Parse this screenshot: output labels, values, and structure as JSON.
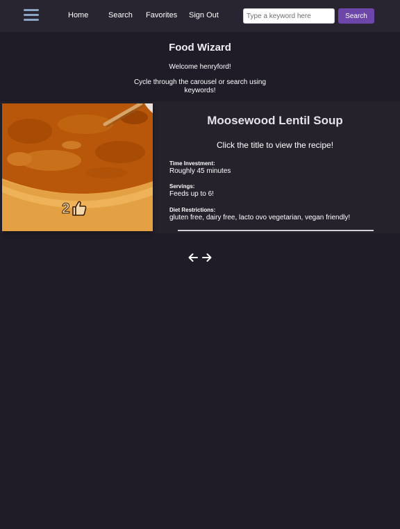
{
  "nav": {
    "menu_icon": "hamburger-menu-icon",
    "links": {
      "home": "Home",
      "search": "Search",
      "favorites": "Favorites",
      "signout": "Sign Out"
    },
    "search": {
      "placeholder": "Type a keyword here",
      "value": "",
      "button_label": "Search"
    }
  },
  "header": {
    "title": "Food Wizard",
    "welcome": "Welcome henryford!",
    "instructions": "Cycle through the carousel or search using keywords!"
  },
  "carousel": {
    "recipe": {
      "title": "Moosewood Lentil Soup",
      "hint": "Click the title to view the recipe!",
      "likes": "2",
      "like_icon": "thumbs-up-icon",
      "image_subject": "lentil soup in a bowl",
      "details": {
        "time_label": "Time Investment:",
        "time_value": "Roughly 45 minutes",
        "servings_label": "Servings:",
        "servings_value": "Feeds up to 6!",
        "diet_label": "Diet Restrictions:",
        "diet_value": "gluten free, dairy free, lacto ovo vegetarian, vegan friendly!"
      }
    },
    "controls": {
      "prev_icon": "arrow-left-icon",
      "next_icon": "arrow-right-icon"
    }
  },
  "colors": {
    "background": "#1f1c28",
    "navbar": "#282530",
    "carousel_panel": "#25222c",
    "accent_button": "#6c46a8",
    "menu_icon": "#8aa6c4",
    "divider": "#d4d1d8"
  }
}
